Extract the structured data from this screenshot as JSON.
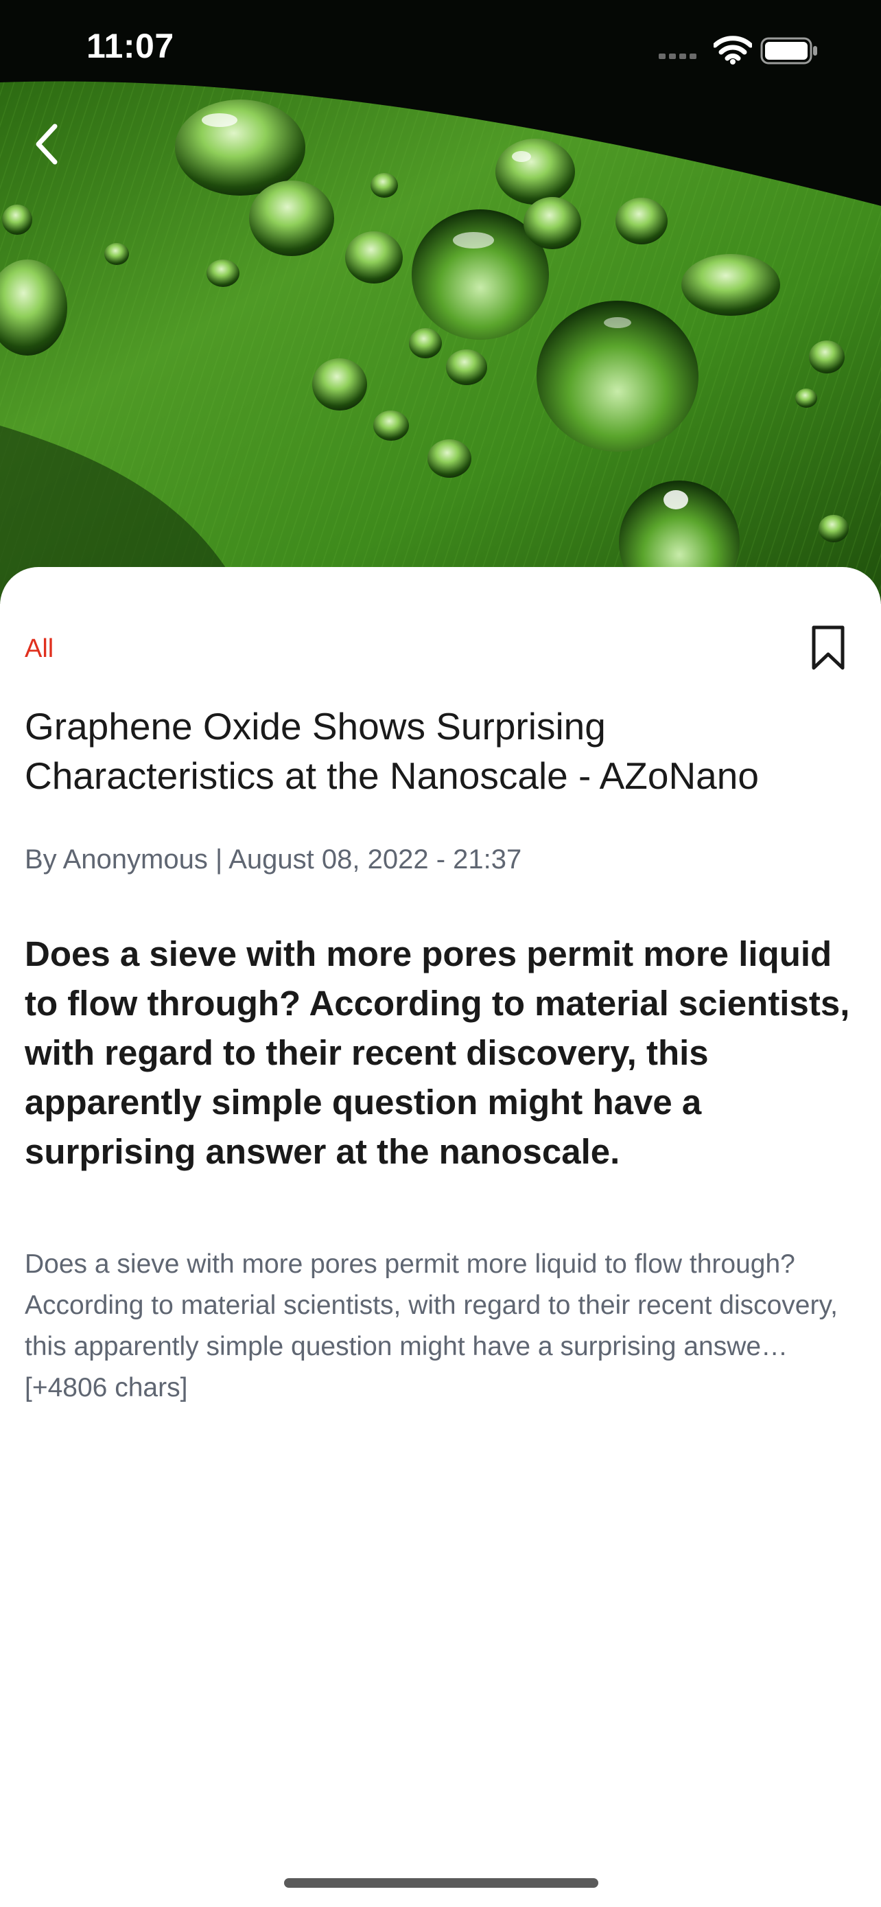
{
  "status_bar": {
    "time": "11:07"
  },
  "hero": {
    "image_subject": "water droplets on green leaf",
    "accent_color": "#3f8a1f"
  },
  "navigation": {
    "back_icon": "chevron-left-icon"
  },
  "article": {
    "category": "All",
    "category_color": "#e0301e",
    "bookmark_icon": "bookmark-icon",
    "title": "Graphene Oxide Shows Surprising Characteristics at the Nanoscale - AZoNano",
    "meta": "By Anonymous | August 08, 2022 - 21:37",
    "lead": "Does a sieve with more pores permit more liquid to flow through? According to material scientists, with regard to their recent discovery, this apparently simple question might have a surprising answer at the nanoscale.",
    "body": "Does a sieve with more pores permit more liquid to flow through? According to material scientists, with regard to their recent discovery, this apparently simple question might have a surprising answe… [+4806 chars]"
  }
}
